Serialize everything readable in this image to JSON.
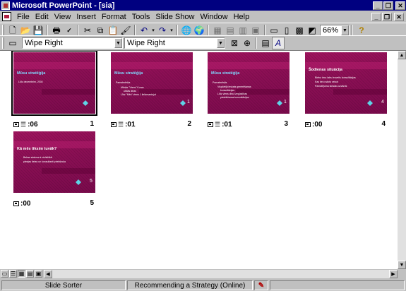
{
  "window": {
    "title": "Microsoft PowerPoint - [sia]",
    "min": "_",
    "restore": "❐",
    "close": "✕"
  },
  "menu": [
    "File",
    "Edit",
    "View",
    "Insert",
    "Format",
    "Tools",
    "Slide Show",
    "Window",
    "Help"
  ],
  "toolbar": {
    "zoom": "66%",
    "icons": [
      "new-icon",
      "open-icon",
      "save-icon",
      "print-icon",
      "spelling-icon",
      "cut-icon",
      "copy-icon",
      "paste-icon",
      "format-painter-icon",
      "undo-icon",
      "redo-icon",
      "hyperlink-icon",
      "web-toolbar-icon",
      "insert-word-table-icon",
      "insert-excel-icon",
      "insert-chart-icon",
      "insert-clip-art-icon",
      "new-slide-icon",
      "slide-layout-icon",
      "apply-design-icon",
      "grayscale-icon",
      "help-icon"
    ]
  },
  "sorter_toolbar": {
    "slide_transition_effect": "Wipe Right",
    "text_preset_animation": "Wipe Right"
  },
  "slides": [
    {
      "number": "1",
      "timing": ":06",
      "title": "Mūsu stratēģija",
      "lines": [
        "Līdz decembrim, 2004"
      ],
      "nav_num": "",
      "selected": true,
      "has_animation": true
    },
    {
      "number": "2",
      "timing": ":01",
      "title": "Mūsu stratēģija",
      "lines": [
        "Pamatmērķis",
        "Mērķis \"Viens\" Kuras",
        "ubilās ātras",
        "Līdz \"Mēs\" viens 1 lielizmantojot"
      ],
      "nav_num": "1",
      "selected": false,
      "has_animation": true
    },
    {
      "number": "3",
      "timing": ":01",
      "title": "Mūsu stratēģija",
      "lines": [
        "Pamatmērķis",
        "Vispārējā ieskats generēšanas",
        "konsultācijas",
        "Līdz viens divu Izegūstības",
        "pieteikšanas konsultācijas"
      ],
      "nav_num": "1",
      "selected": false,
      "has_animation": true
    },
    {
      "number": "4",
      "timing": ":00",
      "title": "Šodienas situācija",
      "lines": [
        "Biebu lecu labs bruvelis konsultācijas",
        "Kas tiek ražots veicot",
        "Pamatējuma strādas uzvārds"
      ],
      "nav_num": "4",
      "selected": false,
      "has_animation": false
    },
    {
      "number": "5",
      "timing": ":00",
      "title": "Kā mēs tiksim tuvāk?",
      "lines": [
        "Bekas sistema ir vislielākā",
        "pieejas lietas un konsultanti priekšroka"
      ],
      "nav_num": "5",
      "selected": false,
      "has_animation": false
    }
  ],
  "status": {
    "view": "Slide Sorter",
    "design": "Recommending a Strategy (Online)"
  },
  "colors": {
    "slide_bg": "#8c0f55",
    "title_accent": "#7fd9ff",
    "nav_accent": "#5fd3e6"
  }
}
